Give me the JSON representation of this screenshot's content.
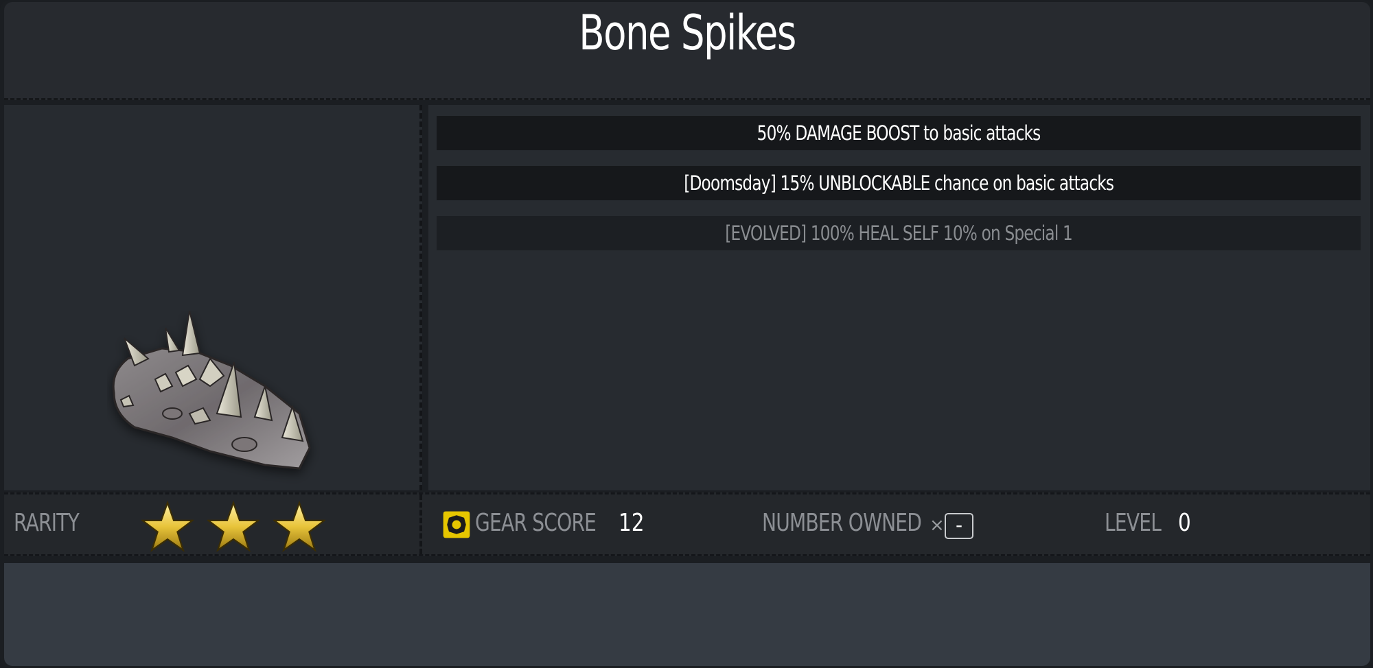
{
  "item": {
    "name": "Bone Spikes",
    "art_icon": "bone-spikes-icon"
  },
  "perks": [
    {
      "text": "50% DAMAGE BOOST to basic attacks",
      "active": true
    },
    {
      "text": "[Doomsday] 15% UNBLOCKABLE chance on basic attacks",
      "active": true
    },
    {
      "text": "[EVOLVED] 100% HEAL SELF 10% on Special 1",
      "active": false
    }
  ],
  "stats": {
    "rarity_label": "RARITY",
    "rarity_stars": 3,
    "gear_score_label": "GEAR SCORE",
    "gear_score_value": "12",
    "number_owned_label": "NUMBER OWNED",
    "number_owned_prefix": "×",
    "number_owned_value": "-",
    "level_label": "LEVEL",
    "level_value": "0"
  },
  "colors": {
    "star_gold": "#e8c43a",
    "gear_icon_yellow": "#e6c600",
    "dim_text": "#8a8d91"
  }
}
